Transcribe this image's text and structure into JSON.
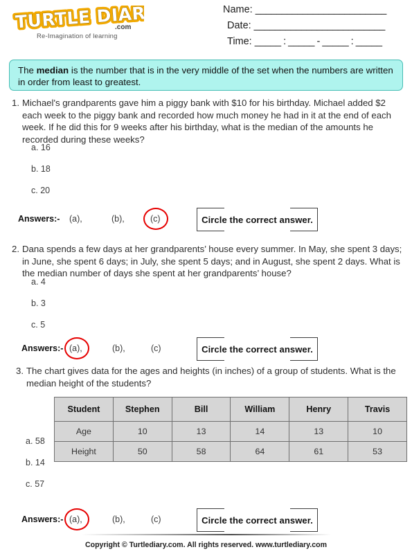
{
  "header": {
    "logo": {
      "text": "TURTLE DIARY",
      "word1": "TURTLE",
      "word2": "DIARY",
      "dotcom": ".com",
      "tagline": "Re-Imagination of learning",
      "color": "#F2A900"
    },
    "fields": [
      {
        "label": "Name:",
        "line": "_________________________"
      },
      {
        "label": "Date:",
        "line": "_________________________"
      },
      {
        "label": "Time:",
        "line": "_____ : _____ - _____ : _____"
      }
    ]
  },
  "definition": {
    "before": "The ",
    "term": "median",
    "after": " is the number that is in the very middle of the set when the numbers are written in order from least to greatest.",
    "bg_color": "#AFF4EE",
    "border_color": "#46BDB4"
  },
  "questions": [
    {
      "number": "1.",
      "text": "Michael's grandparents gave him a piggy bank with $10 for his birthday.  Michael added $2 each week to the piggy bank and recorded how much money he had in it at the end of each week.  If he did this for 9 weeks after his birthday, what is the median of the amounts he recorded during these weeks?",
      "options": [
        "a. 16",
        "b. 18",
        "c. 20"
      ],
      "answers_label": "Answers:-",
      "answer_choices": [
        "(a),",
        "(b),",
        "(c)"
      ],
      "circled_index": 2,
      "cta_label": "Circle the correct answer."
    },
    {
      "number": "2.",
      "text": "Dana spends a few days at her grandparents’ house every summer. In May, she spent 3 days; in June, she spent 6 days; in July, she spent 5 days; and in August, she spent 2 days. What is the median number of days she spent at her grandparents’ house?",
      "options": [
        "a. 4",
        "b. 3",
        "c. 5"
      ],
      "answers_label": "Answers:-",
      "answer_choices": [
        "(a),",
        "(b),",
        "(c)"
      ],
      "circled_index": 0,
      "cta_label": "Circle the correct answer."
    },
    {
      "number": "3.",
      "text": "The chart gives data for the ages and heights (in inches) of a group of students. What is the median height of the students?",
      "options": [
        "a. 58",
        "b. 14",
        "c. 57"
      ],
      "answers_label": "Answers:-",
      "answer_choices": [
        "(a),",
        "(b),",
        "(c)"
      ],
      "circled_index": 0,
      "cta_label": "Circle the correct answer."
    }
  ],
  "chart_data": {
    "type": "table",
    "title": "Ages and heights (in inches) of a group of students",
    "columns": [
      "Student",
      "Stephen",
      "Bill",
      "William",
      "Henry",
      "Travis"
    ],
    "rows": [
      {
        "label": "Age",
        "values": [
          "10",
          "13",
          "14",
          "13",
          "10"
        ]
      },
      {
        "label": "Height",
        "values": [
          "50",
          "58",
          "64",
          "61",
          "53"
        ]
      }
    ]
  },
  "footer": {
    "text": "Copyright © Turtlediary.com. All rights reserved. www.turtlediary.com"
  },
  "colors": {
    "circle_red": "#E60000",
    "table_bg": "#D6D6D6",
    "table_border": "#6F6F6F"
  }
}
